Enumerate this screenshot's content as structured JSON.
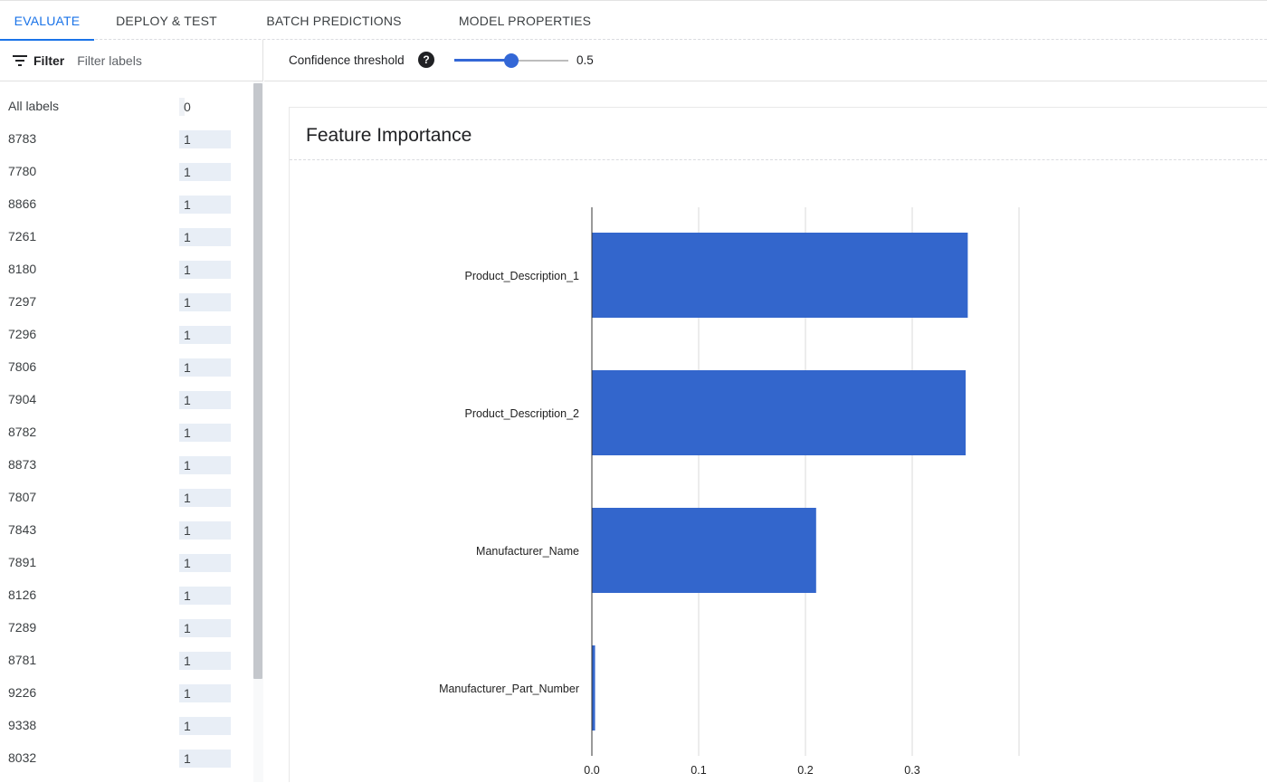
{
  "tabs": [
    {
      "label": "EVALUATE",
      "active": true
    },
    {
      "label": "DEPLOY & TEST",
      "active": false
    },
    {
      "label": "BATCH PREDICTIONS",
      "active": false
    },
    {
      "label": "MODEL PROPERTIES",
      "active": false
    }
  ],
  "sidebar": {
    "filter_label": "Filter",
    "filter_placeholder": "Filter labels",
    "labels": [
      {
        "name": "All labels",
        "count": "0"
      },
      {
        "name": "8783",
        "count": "1"
      },
      {
        "name": "7780",
        "count": "1"
      },
      {
        "name": "8866",
        "count": "1"
      },
      {
        "name": "7261",
        "count": "1"
      },
      {
        "name": "8180",
        "count": "1"
      },
      {
        "name": "7297",
        "count": "1"
      },
      {
        "name": "7296",
        "count": "1"
      },
      {
        "name": "7806",
        "count": "1"
      },
      {
        "name": "7904",
        "count": "1"
      },
      {
        "name": "8782",
        "count": "1"
      },
      {
        "name": "8873",
        "count": "1"
      },
      {
        "name": "7807",
        "count": "1"
      },
      {
        "name": "7843",
        "count": "1"
      },
      {
        "name": "7891",
        "count": "1"
      },
      {
        "name": "8126",
        "count": "1"
      },
      {
        "name": "7289",
        "count": "1"
      },
      {
        "name": "8781",
        "count": "1"
      },
      {
        "name": "9226",
        "count": "1"
      },
      {
        "name": "9338",
        "count": "1"
      },
      {
        "name": "8032",
        "count": "1"
      }
    ]
  },
  "toolbar": {
    "confidence_label": "Confidence threshold",
    "help_icon": "help-circle-icon",
    "threshold_value": "0.5",
    "threshold_fraction": 0.5
  },
  "card": {
    "title": "Feature Importance"
  },
  "colors": {
    "accent": "#1a73e8",
    "bar": "#3366cc",
    "slider": "#3367d6"
  },
  "chart_data": {
    "type": "bar",
    "orientation": "horizontal",
    "categories": [
      "Product_Description_1",
      "Product_Description_2",
      "Manufacturer_Name",
      "Manufacturer_Part_Number"
    ],
    "values": [
      0.352,
      0.35,
      0.21,
      0.003
    ],
    "xlim": [
      0,
      0.4
    ],
    "xticks": [
      "0.0",
      "0.1",
      "0.2",
      "0.3"
    ],
    "grid": true
  }
}
